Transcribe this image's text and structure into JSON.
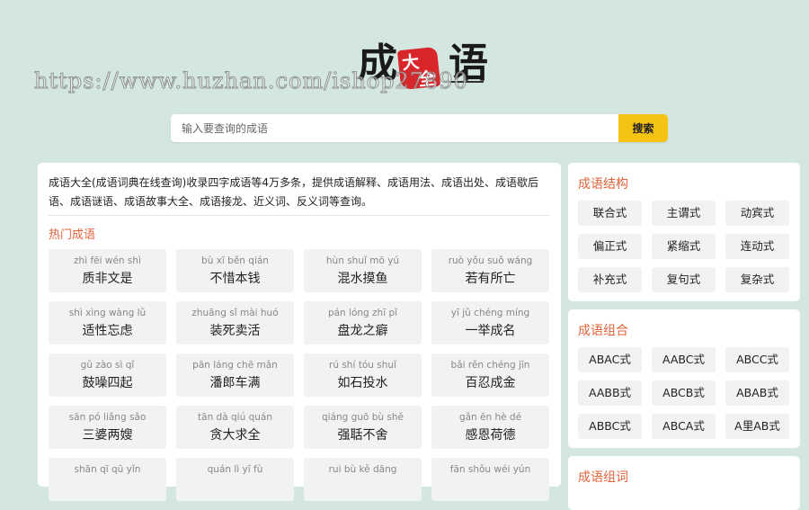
{
  "logo": {
    "char_left": "成",
    "seal_top": "大",
    "seal_bottom": "全",
    "char_right": "语"
  },
  "watermark": "https://www.huzhan.com/ishop27890",
  "search": {
    "placeholder": "输入要查询的成语",
    "button_label": "搜索"
  },
  "intro": "成语大全(成语词典在线查询)收录四字成语等4万多条，提供成语解释、成语用法、成语出处、成语歇后语、成语谜语、成语故事大全、成语接龙、近义词、反义词等查询。",
  "hot": {
    "title": "热门成语",
    "items": [
      {
        "pinyin": "zhì fēi wén shì",
        "idiom": "质非文是"
      },
      {
        "pinyin": "bù xī běn qián",
        "idiom": "不惜本钱"
      },
      {
        "pinyin": "hùn shuǐ mō yú",
        "idiom": "混水摸鱼"
      },
      {
        "pinyin": "ruò yǒu suǒ wáng",
        "idiom": "若有所亡"
      },
      {
        "pinyin": "shì xìng wàng lǜ",
        "idiom": "适性忘虑"
      },
      {
        "pinyin": "zhuāng sǐ mài huó",
        "idiom": "装死卖活"
      },
      {
        "pinyin": "pán lóng zhī pǐ",
        "idiom": "盘龙之癖"
      },
      {
        "pinyin": "yī jǔ chéng míng",
        "idiom": "一举成名"
      },
      {
        "pinyin": "gǔ zào sì qǐ",
        "idiom": "鼓噪四起"
      },
      {
        "pinyin": "pān láng chē mǎn",
        "idiom": "潘郎车满"
      },
      {
        "pinyin": "rú shí tóu shuǐ",
        "idiom": "如石投水"
      },
      {
        "pinyin": "bǎi rěn chéng jīn",
        "idiom": "百忍成金"
      },
      {
        "pinyin": "sān pó liǎng sǎo",
        "idiom": "三婆两嫂"
      },
      {
        "pinyin": "tān dà qiú quán",
        "idiom": "贪大求全"
      },
      {
        "pinyin": "qiáng guō bù shě",
        "idiom": "强聒不舍"
      },
      {
        "pinyin": "gǎn ēn hè dé",
        "idiom": "感恩荷德"
      },
      {
        "pinyin": "shān qī qū yǐn",
        "idiom": ""
      },
      {
        "pinyin": "quán lì yī fù",
        "idiom": ""
      },
      {
        "pinyin": "rui bù kě dāng",
        "idiom": ""
      },
      {
        "pinyin": "fān shǒu wéi yún",
        "idiom": ""
      }
    ]
  },
  "structure": {
    "title": "成语结构",
    "items": [
      "联合式",
      "主谓式",
      "动宾式",
      "偏正式",
      "紧缩式",
      "连动式",
      "补充式",
      "复句式",
      "复杂式"
    ]
  },
  "combination": {
    "title": "成语组合",
    "items": [
      "ABAC式",
      "AABC式",
      "ABCC式",
      "AABB式",
      "ABCB式",
      "ABAB式",
      "ABBC式",
      "ABCA式",
      "A里AB式"
    ]
  },
  "third_section": {
    "title": "成语组词"
  }
}
